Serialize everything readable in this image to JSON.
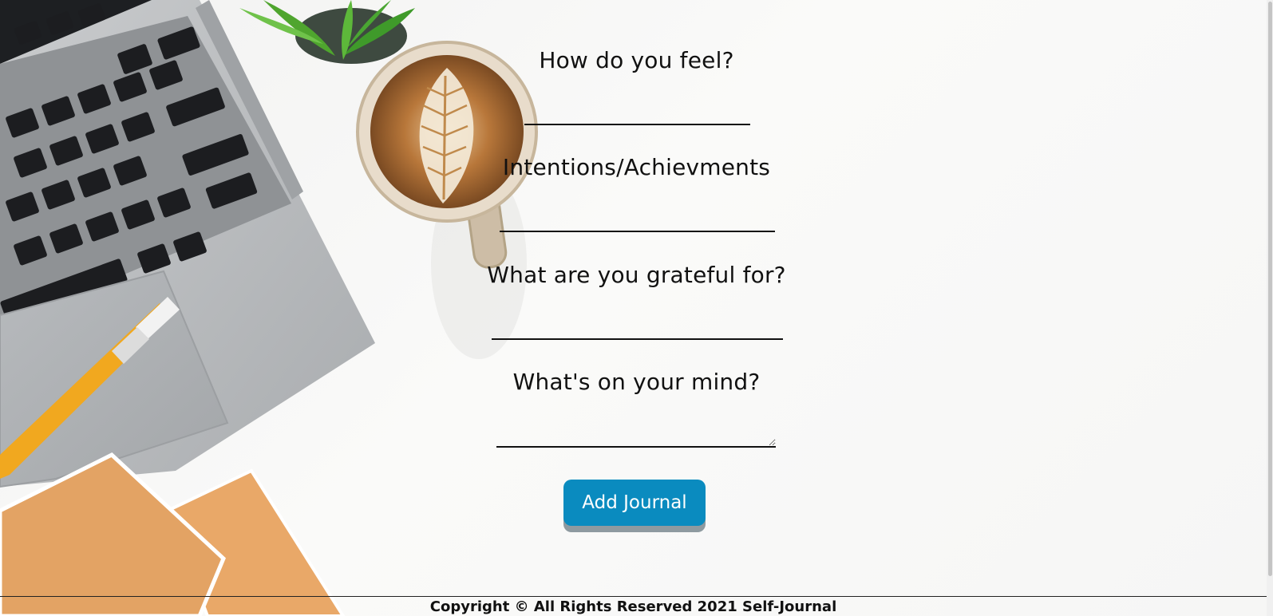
{
  "form": {
    "questions": [
      {
        "label": "How do you feel?",
        "value": ""
      },
      {
        "label": "Intentions/Achievments",
        "value": ""
      },
      {
        "label": "What are you grateful for?",
        "value": ""
      },
      {
        "label": "What's on your mind?",
        "value": ""
      }
    ],
    "submit_label": "Add Journal"
  },
  "footer": {
    "text": "Copyright © All Rights Reserved 2021 Self-Journal"
  },
  "colors": {
    "button": "#0a8bbf",
    "button_shadow": "#8e9aa0",
    "text": "#111111",
    "background": "#f7f7f6"
  },
  "background_image": {
    "icons": [
      "laptop-icon",
      "coffee-cup-icon",
      "potted-plant-icon",
      "pencil-icon",
      "notebook-icon"
    ]
  }
}
